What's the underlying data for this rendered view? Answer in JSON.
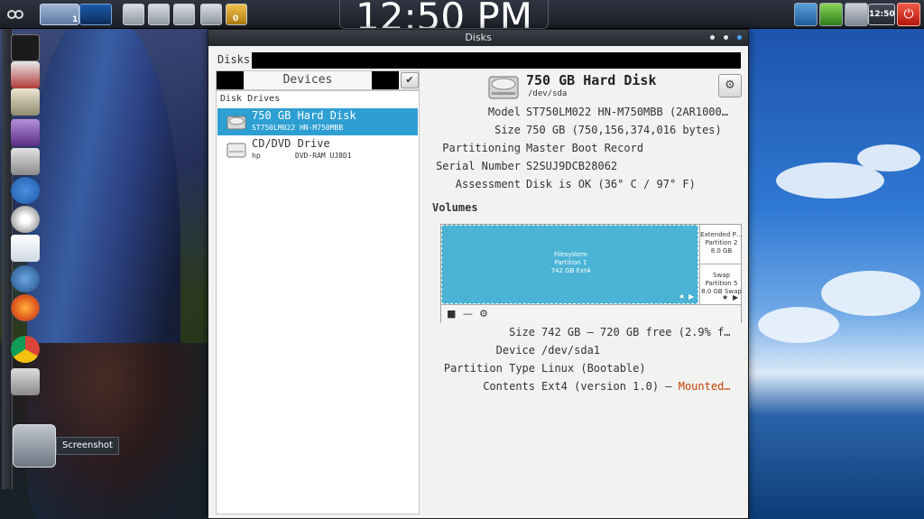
{
  "top_panel": {
    "clock_big": "12:50 PM",
    "clock_small": "12:50",
    "workspace_badge": "1",
    "notification_badge": "0"
  },
  "dock": {
    "tooltip": "Screenshot"
  },
  "window": {
    "title": "Disks",
    "toolbar_label": "Disks"
  },
  "devices": {
    "header": "Devices",
    "section": "Disk Drives",
    "items": [
      {
        "name": "750 GB Hard Disk",
        "sub": "ST750LM022 HN-M750MBB",
        "vendor": ""
      },
      {
        "name": "CD/DVD Drive",
        "sub": "hp",
        "vendor": "DVD-RAM UJ8D1"
      }
    ]
  },
  "disk": {
    "title": "750 GB Hard Disk",
    "path": "/dev/sda",
    "props": [
      {
        "key": "Model",
        "value": "ST750LM022 HN-M750MBB (2AR1000…"
      },
      {
        "key": "Size",
        "value": "750 GB (750,156,374,016 bytes)"
      },
      {
        "key": "Partitioning",
        "value": "Master Boot Record"
      },
      {
        "key": "Serial Number",
        "value": "S2SUJ9DCB28062"
      },
      {
        "key": "Assessment",
        "value": "Disk is OK (36° C / 97° F)"
      }
    ]
  },
  "volumes": {
    "header": "Volumes",
    "partition1": {
      "line1": "Filesystem",
      "line2": "Partition 1",
      "line3": "742 GB Ext4"
    },
    "extended": {
      "line1": "Extended P…",
      "line2": "Partition 2",
      "line3": "8.0 GB"
    },
    "swap": {
      "line1": "Swap",
      "line2": "Partition 5",
      "line3": "8.0 GB Swap"
    },
    "props": [
      {
        "key": "Size",
        "value": "742 GB — 720 GB free (2.9% f…"
      },
      {
        "key": "Device",
        "value": "/dev/sda1"
      },
      {
        "key": "Partition Type",
        "value": "Linux (Bootable)"
      },
      {
        "key": "Contents",
        "value": "Ext4 (version 1.0) — ",
        "link": "Mounted…"
      }
    ]
  },
  "colors": {
    "selection": "#2e9fd2",
    "partition": "#4ab3d6",
    "link": "#c04000"
  }
}
